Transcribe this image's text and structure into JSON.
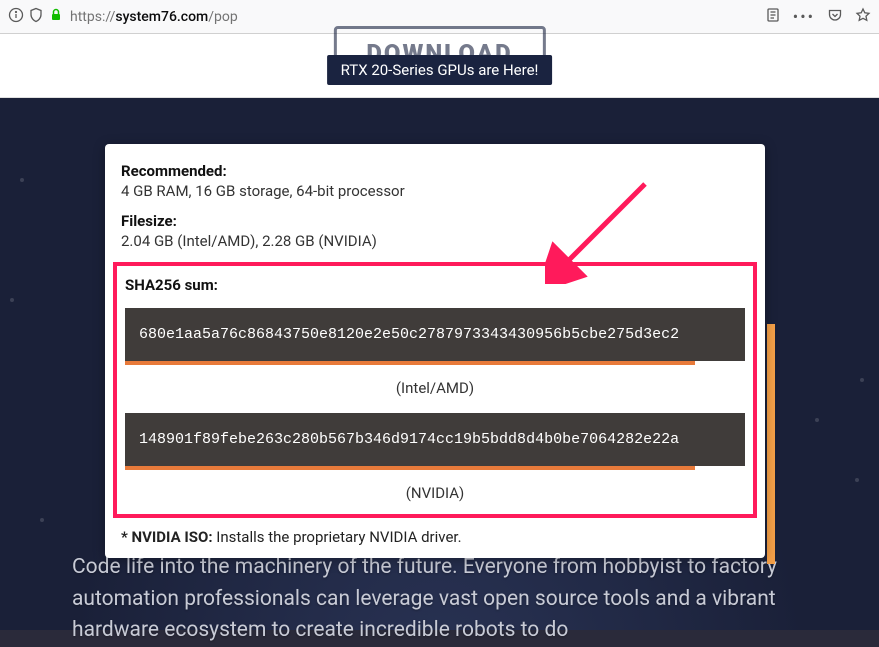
{
  "browser": {
    "url_prefix": "https://",
    "url_domain": "system76.com",
    "url_path": "/pop"
  },
  "top": {
    "download_label": "DOWNLOAD",
    "banner_text": "RTX 20-Series GPUs are Here!"
  },
  "modal": {
    "recommended_label": "Recommended:",
    "recommended_value": "4 GB RAM, 16 GB storage, 64-bit processor",
    "filesize_label": "Filesize:",
    "filesize_value": "2.04 GB (Intel/AMD), 2.28 GB (NVIDIA)",
    "sha_label": "SHA256 sum:",
    "hashes": [
      {
        "value": "680e1aa5a76c86843750e8120e2e50c2787973343430956b5cbe275d3ec2",
        "label": "(Intel/AMD)"
      },
      {
        "value": "148901f89febe263c280b567b346d9174cc19b5bdd8d4b0be7064282e22a",
        "label": "(NVIDIA)"
      }
    ],
    "footnote_bold": "* NVIDIA ISO:",
    "footnote_text": " Installs the proprietary NVIDIA driver."
  },
  "bg_text": "Code life into the machinery of the future. Everyone from hobbyist to factory automation professionals can leverage vast open source tools and a vibrant hardware ecosystem to create incredible robots to do"
}
